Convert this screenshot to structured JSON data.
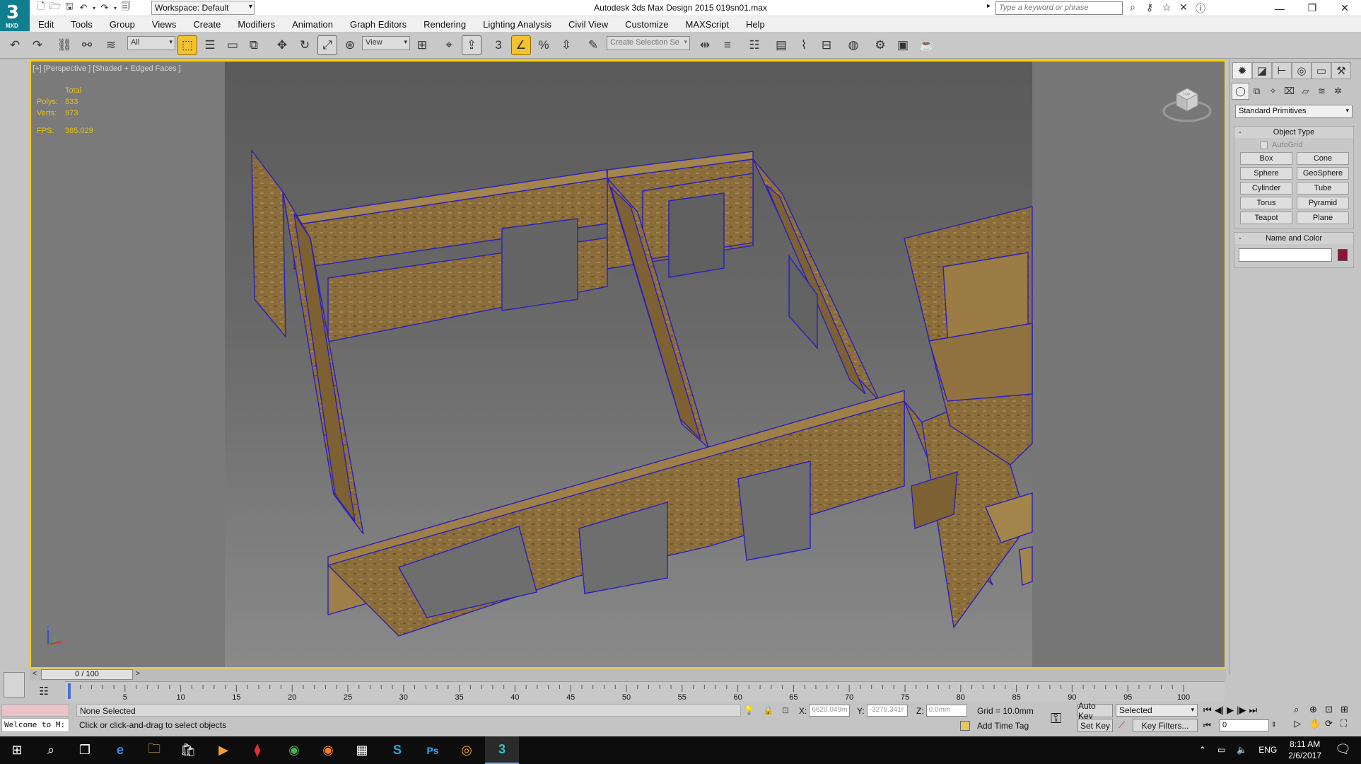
{
  "app": {
    "logo_text": "3",
    "logo_sub": "MXD",
    "window_title": "Autodesk 3ds Max Design 2015      019sn01.max",
    "workspace": "Workspace: Default",
    "search_placeholder": "Type a keyword or phrase"
  },
  "menu": [
    "Edit",
    "Tools",
    "Group",
    "Views",
    "Create",
    "Modifiers",
    "Animation",
    "Graph Editors",
    "Rendering",
    "Lighting Analysis",
    "Civil View",
    "Customize",
    "MAXScript",
    "Help"
  ],
  "toolbar": {
    "selection_filter": "All",
    "ref_coord": "View",
    "snap_toggle_label": "3",
    "named_selection_placeholder": "Create Selection Se"
  },
  "viewport": {
    "label": "[+] [Perspective ] [Shaded + Edged Faces ]",
    "stats": {
      "header": "Total",
      "polys_label": "Polys:",
      "polys": "833",
      "verts_label": "Verts:",
      "verts": "973",
      "fps_label": "FPS:",
      "fps": "365.029"
    },
    "axis": {
      "x": "x",
      "y": "y",
      "z": "z"
    },
    "viewcube_label": "TOP",
    "colors": {
      "wood": "#8a6d3b",
      "edges": "#2a1fbf",
      "active_border": "#f5d000",
      "stats_text": "#e3c21a"
    }
  },
  "command_panel": {
    "category": "Standard Primitives",
    "object_type_title": "Object Type",
    "autogrid": "AutoGrid",
    "primitives": [
      "Box",
      "Cone",
      "Sphere",
      "GeoSphere",
      "Cylinder",
      "Tube",
      "Torus",
      "Pyramid",
      "Teapot",
      "Plane"
    ],
    "name_color_title": "Name and Color",
    "name_value": "",
    "object_color": "#8a1535"
  },
  "timeline": {
    "frame_label": "0 / 100",
    "ticks": [
      "5",
      "10",
      "15",
      "20",
      "25",
      "30",
      "35",
      "40",
      "45",
      "50",
      "55",
      "60",
      "65",
      "70",
      "75",
      "80",
      "85",
      "90",
      "95",
      "100"
    ]
  },
  "status": {
    "listener": "Welcome to M:",
    "selection": "None Selected",
    "prompt": "Click or click-and-drag to select objects",
    "x_label": "X:",
    "x_value": "6620.049m",
    "y_label": "Y:",
    "y_value": "-3278.341r",
    "z_label": "Z:",
    "z_value": "0.0mm",
    "grid": "Grid = 10.0mm",
    "add_time_tag": "Add Time Tag",
    "auto_key": "Auto Key",
    "set_key": "Set Key",
    "key_mode": "Selected",
    "key_filters": "Key Filters...",
    "current_frame": "0"
  },
  "taskbar": {
    "lang": "ENG",
    "time": "8:11 AM",
    "date": "2/6/2017"
  }
}
